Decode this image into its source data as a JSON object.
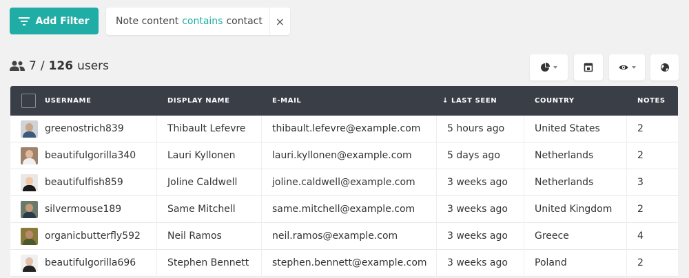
{
  "toolbar": {
    "add_filter_label": "Add Filter"
  },
  "filter": {
    "field": "Note content",
    "operator": "contains",
    "value": "contact",
    "close": "×"
  },
  "summary": {
    "shown": "7",
    "separator": "/",
    "total": "126",
    "unit": "users"
  },
  "tools": [
    {
      "name": "chart-pie-icon",
      "has_caret": true
    },
    {
      "name": "export-icon",
      "has_caret": false
    },
    {
      "name": "eye-icon",
      "has_caret": true
    },
    {
      "name": "globe-icon",
      "has_caret": false
    }
  ],
  "columns": {
    "username": "USERNAME",
    "display_name": "DISPLAY NAME",
    "email": "E-MAIL",
    "last_seen": "LAST SEEN",
    "last_seen_sort": "↓",
    "country": "COUNTRY",
    "notes": "NOTES"
  },
  "rows": [
    {
      "username": "greenostrich839",
      "display_name": "Thibault Lefevre",
      "email": "thibault.lefevre@example.com",
      "last_seen": "5 hours ago",
      "country": "United States",
      "notes": "2",
      "avatar_bg": "#cfd3d8",
      "avatar_skin": "#c9a58a",
      "avatar_cloth": "#3c5a7a"
    },
    {
      "username": "beautifulgorilla340",
      "display_name": "Lauri Kyllonen",
      "email": "lauri.kyllonen@example.com",
      "last_seen": "5 days ago",
      "country": "Netherlands",
      "notes": "2",
      "avatar_bg": "#a0826a",
      "avatar_skin": "#e0b8a0",
      "avatar_cloth": "#f0f0f0"
    },
    {
      "username": "beautifulfish859",
      "display_name": "Joline Caldwell",
      "email": "joline.caldwell@example.com",
      "last_seen": "3 weeks ago",
      "country": "Netherlands",
      "notes": "3",
      "avatar_bg": "#e8e8e8",
      "avatar_skin": "#f0c8a8",
      "avatar_cloth": "#1a1a1a"
    },
    {
      "username": "silvermouse189",
      "display_name": "Same Mitchell",
      "email": "same.mitchell@example.com",
      "last_seen": "3 weeks ago",
      "country": "United Kingdom",
      "notes": "2",
      "avatar_bg": "#6a7a6a",
      "avatar_skin": "#c49a7a",
      "avatar_cloth": "#2a3a4a"
    },
    {
      "username": "organicbutterfly592",
      "display_name": "Neil Ramos",
      "email": "neil.ramos@example.com",
      "last_seen": "3 weeks ago",
      "country": "Greece",
      "notes": "4",
      "avatar_bg": "#8a7a3a",
      "avatar_skin": "#b98a6a",
      "avatar_cloth": "#4a5a2a"
    },
    {
      "username": "beautifulgorilla696",
      "display_name": "Stephen Bennett",
      "email": "stephen.bennett@example.com",
      "last_seen": "3 weeks ago",
      "country": "Poland",
      "notes": "2",
      "avatar_bg": "#f0f0f0",
      "avatar_skin": "#e0c0a8",
      "avatar_cloth": "#222222"
    }
  ]
}
